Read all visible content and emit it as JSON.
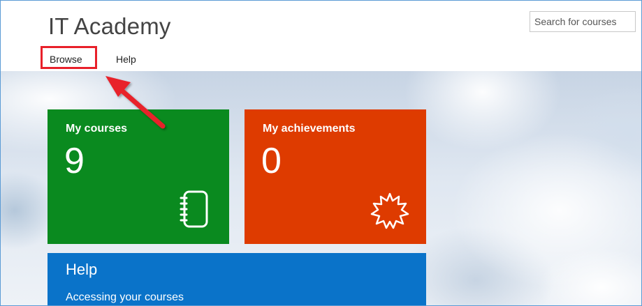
{
  "header": {
    "app_title": "IT Academy",
    "search_placeholder": "Search for courses",
    "nav": {
      "browse_label": "Browse",
      "help_label": "Help"
    }
  },
  "tiles": {
    "courses": {
      "label": "My courses",
      "count": "9",
      "color": "#0a8a1f",
      "icon": "notebook-icon"
    },
    "achievements": {
      "label": "My achievements",
      "count": "0",
      "color": "#de3b00",
      "icon": "starburst-badge-icon"
    },
    "help": {
      "title": "Help",
      "link": "Accessing your courses",
      "color": "#0a73c9"
    }
  },
  "annotation": {
    "highlight_color": "#e8202a",
    "arrow": "red-arrow-icon"
  }
}
